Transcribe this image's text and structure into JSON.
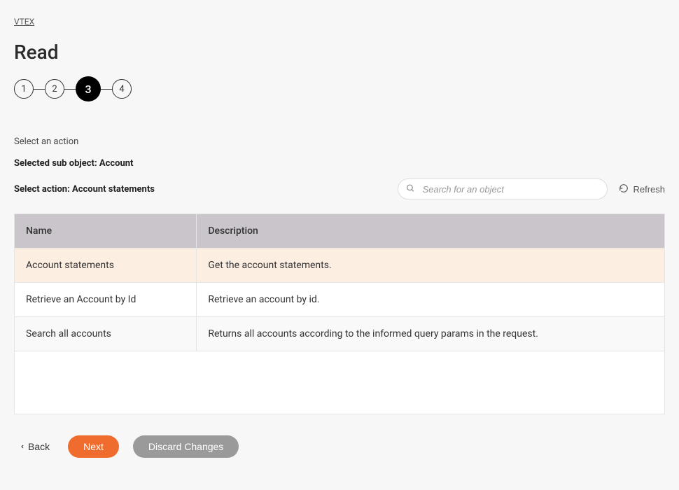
{
  "breadcrumb": "VTEX",
  "page_title": "Read",
  "stepper": {
    "steps": [
      "1",
      "2",
      "3",
      "4"
    ],
    "active_index": 2
  },
  "instruction": "Select an action",
  "selected_sub_object_label": "Selected sub object: Account",
  "select_action_label": "Select action: Account statements",
  "search": {
    "placeholder": "Search for an object"
  },
  "refresh_label": "Refresh",
  "table": {
    "headers": {
      "name": "Name",
      "description": "Description"
    },
    "rows": [
      {
        "name": "Account statements",
        "description": "Get the account statements.",
        "selected": true
      },
      {
        "name": "Retrieve an Account by Id",
        "description": "Retrieve an account by id.",
        "selected": false
      },
      {
        "name": "Search all accounts",
        "description": "Returns all accounts according to the informed query params in the request.",
        "selected": false
      }
    ]
  },
  "buttons": {
    "back": "Back",
    "next": "Next",
    "discard": "Discard Changes"
  }
}
